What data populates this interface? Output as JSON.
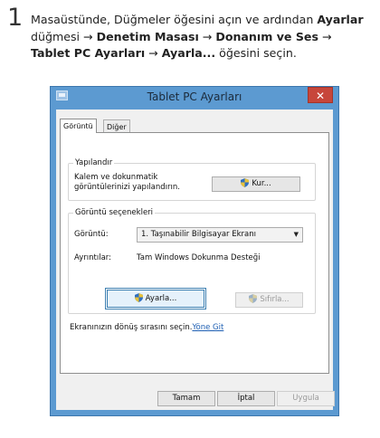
{
  "instruction": {
    "step_number": "1",
    "part1": "Masaüstünde, Düğmeler öğesini açın ve ardından ",
    "bold1": "Ayarlar",
    "part2": " düğmesi → ",
    "bold2": "Denetim Masası",
    "part3": " → ",
    "bold3": "Donanım ve Ses",
    "part4": " → ",
    "bold4": "Tablet PC Ayarları",
    "part5": " → ",
    "bold5": "Ayarla...",
    "part6": " öğesini seçin."
  },
  "window": {
    "title": "Tablet PC Ayarları",
    "close_glyph": "✕"
  },
  "tabs": [
    {
      "label": "Görüntü",
      "active": true
    },
    {
      "label": "Diğer",
      "active": false
    }
  ],
  "configure_group": {
    "legend": "Yapılandır",
    "description": "Kalem ve dokunmatik görüntülerinizi yapılandırın.",
    "setup_button": "Kur..."
  },
  "display_group": {
    "legend": "Görüntü seçenekleri",
    "display_label": "Görüntü:",
    "display_value": "1. Taşınabilir Bilgisayar Ekranı",
    "details_label": "Ayrıntılar:",
    "details_value": "Tam Windows Dokunma Desteği",
    "calibrate_button": "Ayarla...",
    "reset_button": "Sıfırla..."
  },
  "rotation": {
    "text": "Ekranınızın dönüş sırasını seçin.",
    "link": "Yöne Git"
  },
  "footer": {
    "ok": "Tamam",
    "cancel": "İptal",
    "apply": "Uygula"
  },
  "icons": {
    "shield": "uac-shield-icon",
    "app": "tablet-settings-icon",
    "dropdown": "chevron-down-icon"
  },
  "colors": {
    "window_frame": "#5c9ad1",
    "close_button": "#c7463a",
    "link": "#1e5fb3"
  }
}
